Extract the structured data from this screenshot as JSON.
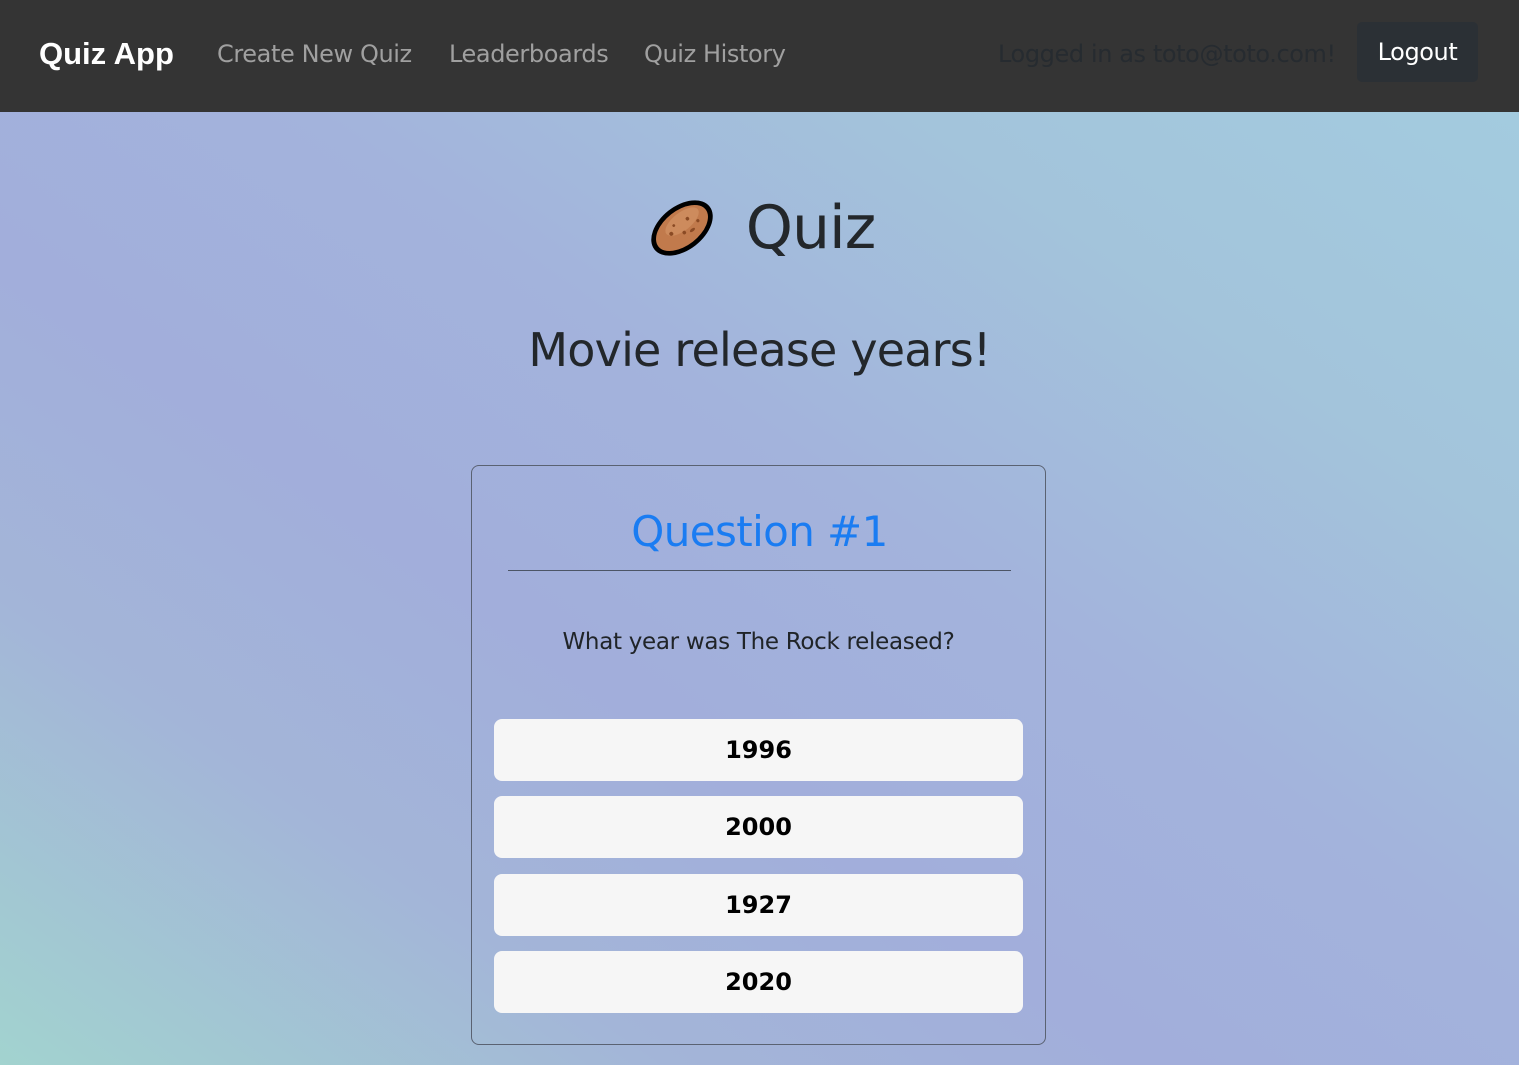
{
  "navbar": {
    "brand": "Quiz App",
    "links": [
      "Create New Quiz",
      "Leaderboards",
      "Quiz History"
    ],
    "logged_in_text": "Logged in as toto@toto.com!",
    "logout_label": "Logout"
  },
  "header": {
    "icon": "potato-icon",
    "title": "Quiz",
    "subtitle": "Movie release years!"
  },
  "question_card": {
    "heading": "Question #1",
    "question": "What year was The Rock released?",
    "answers": [
      "1996",
      "2000",
      "1927",
      "2020"
    ]
  },
  "colors": {
    "navbar_bg": "#343434",
    "accent": "#1a7cf2",
    "answer_bg": "#f6f6f6",
    "logout_bg": "#2b3035"
  }
}
